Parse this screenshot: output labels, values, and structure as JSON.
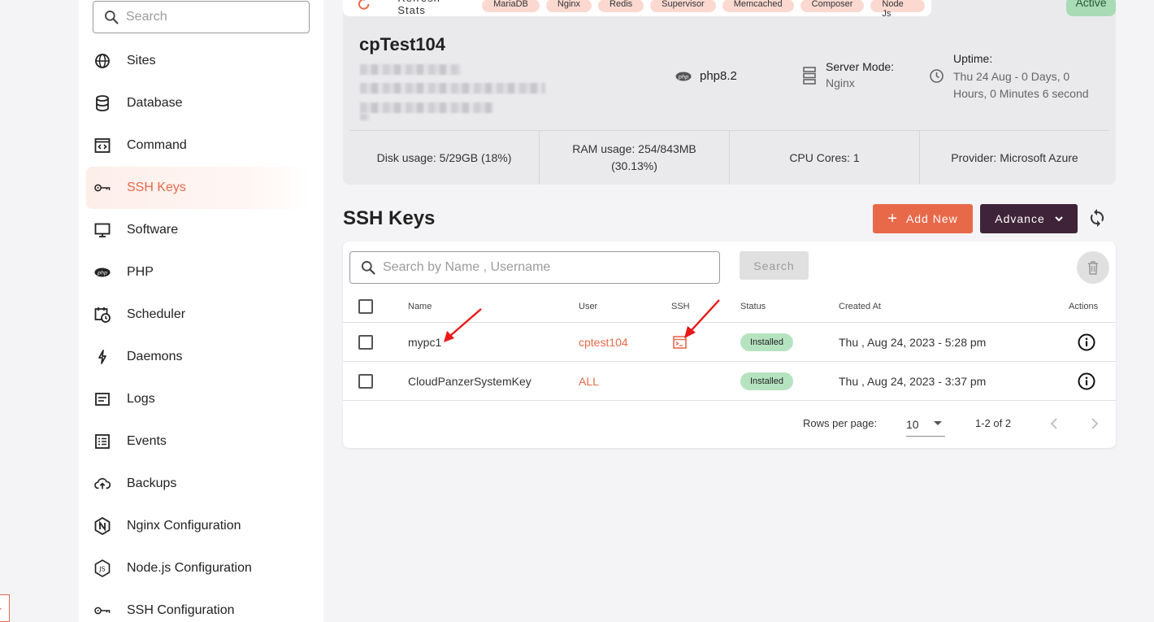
{
  "sidebar": {
    "search_placeholder": "Search",
    "items": [
      {
        "label": "Sites",
        "icon": "globe-icon"
      },
      {
        "label": "Database",
        "icon": "database-icon"
      },
      {
        "label": "Command",
        "icon": "code-window-icon"
      },
      {
        "label": "SSH Keys",
        "icon": "key-icon",
        "active": true
      },
      {
        "label": "Software",
        "icon": "monitor-icon"
      },
      {
        "label": "PHP",
        "icon": "php-icon"
      },
      {
        "label": "Scheduler",
        "icon": "calendar-clock-icon"
      },
      {
        "label": "Daemons",
        "icon": "bolt-icon"
      },
      {
        "label": "Logs",
        "icon": "log-list-icon"
      },
      {
        "label": "Events",
        "icon": "events-list-icon"
      },
      {
        "label": "Backups",
        "icon": "cloud-upload-icon"
      },
      {
        "label": "Nginx Configuration",
        "icon": "nginx-icon"
      },
      {
        "label": "Node.js Configuration",
        "icon": "nodejs-icon"
      },
      {
        "label": "SSH Configuration",
        "icon": "key-icon"
      }
    ]
  },
  "server": {
    "refresh_label": "Refresh Stats",
    "tags": [
      "MariaDB",
      "Nginx",
      "Redis",
      "Supervisor",
      "Memcached",
      "Composer",
      "Node Js"
    ],
    "status": "Active",
    "name": "cpTest104",
    "php_version": "php8.2",
    "mode_label": "Server Mode:",
    "mode_value": "Nginx",
    "uptime_label": "Uptime:",
    "uptime_value": "Thu 24 Aug - 0 Days, 0 Hours, 0 Minutes 6 second",
    "stats": [
      {
        "label": "Disk usage:",
        "value": "5/29GB (18%)"
      },
      {
        "label": "RAM usage:",
        "value": "254/843MB (30.13%)"
      },
      {
        "label": "CPU Cores:",
        "value": "1"
      },
      {
        "label": "Provider:",
        "value": "Microsoft Azure"
      }
    ]
  },
  "page": {
    "title": "SSH Keys",
    "add_label": "Add New",
    "advance_label": "Advance"
  },
  "table": {
    "search_placeholder": "Search by Name , Username",
    "search_button": "Search",
    "columns": [
      "Name",
      "User",
      "SSH",
      "Status",
      "Created At",
      "Actions"
    ],
    "rows": [
      {
        "name": "mypc1",
        "user": "cptest104",
        "has_ssh": true,
        "status": "Installed",
        "created": "Thu , Aug 24, 2023 - 5:28 pm"
      },
      {
        "name": "CloudPanzerSystemKey",
        "user": "ALL",
        "has_ssh": false,
        "status": "Installed",
        "created": "Thu , Aug 24, 2023 - 3:37 pm"
      }
    ],
    "rows_per_page_label": "Rows per page:",
    "rows_per_page": "10",
    "range": "1-2 of 2"
  },
  "colors": {
    "accent": "#e8694a",
    "dark_button": "#3f2439",
    "status_green": "#b5e3c0"
  }
}
